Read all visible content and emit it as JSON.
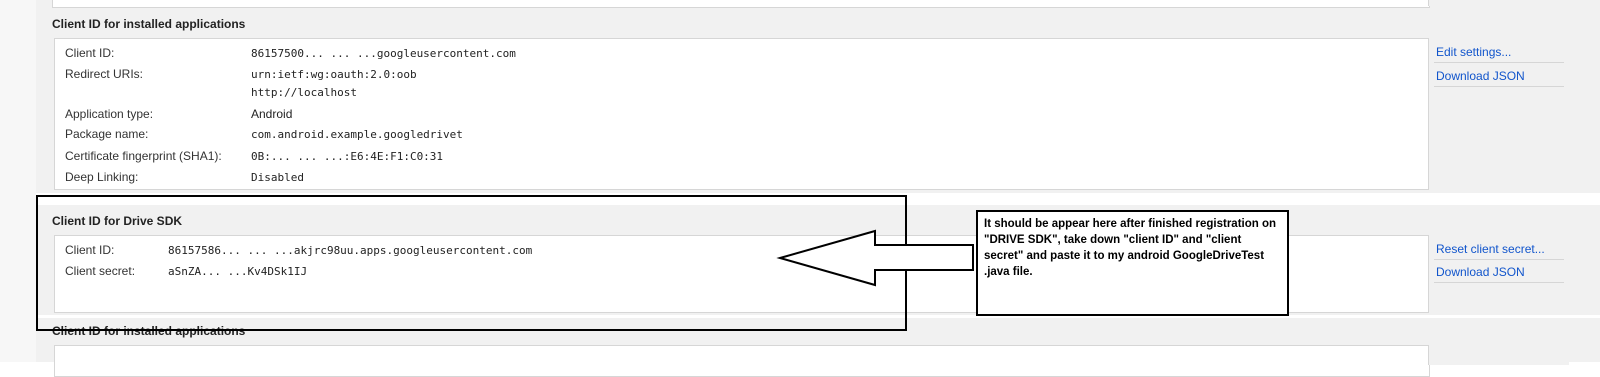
{
  "installed_section": {
    "title": "Client ID for installed applications",
    "rows": [
      {
        "label": "Client ID:",
        "value": "86157500...   ...  ...googleusercontent.com"
      },
      {
        "label": "Redirect URIs:",
        "value": "urn:ietf:wg:oauth:2.0:oob",
        "value2": "http://localhost"
      },
      {
        "label": "Application type:",
        "value": "Android"
      },
      {
        "label": "Package name:",
        "value": "com.android.example.googledrivet"
      },
      {
        "label": "Certificate fingerprint (SHA1):",
        "value": "0B:...   ...   ...:E6:4E:F1:C0:31"
      },
      {
        "label": "Deep Linking:",
        "value": "Disabled"
      }
    ],
    "actions": [
      "Edit settings...",
      "Download JSON"
    ]
  },
  "drive_section": {
    "title": "Client ID for Drive SDK",
    "rows": [
      {
        "label": "Client ID:",
        "value": "86157586...   ...   ...akjrc98uu.apps.googleusercontent.com"
      },
      {
        "label": "Client secret:",
        "value": "aSnZA...   ...Kv4DSk1IJ"
      }
    ],
    "actions": [
      "Reset client secret...",
      "Download JSON"
    ]
  },
  "bottom_section": {
    "title": "Client ID for installed applications"
  },
  "annotation": {
    "text": "It should be appear here after finished registration on \"DRIVE SDK\", take down \"client ID\" and \"client secret\" and paste it to my android GoogleDriveTest .java file."
  }
}
